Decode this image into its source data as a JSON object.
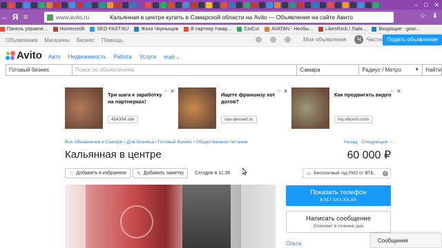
{
  "browser": {
    "ya_logo": "Я",
    "url": "www.avito.ru",
    "page_title": "Кальянная в центре купить в Самарской области на Avito — Объявления на сайте Авито",
    "tab_icon_colors": [
      "#2c3e50",
      "#e74c3c",
      "#2c3e50",
      "#3498db",
      "#2c3e50",
      "#27ae60",
      "#e67e22",
      "#c0392b",
      "#2c3e50",
      "#3498db",
      "#c0392b",
      "#2980b9",
      "#2c3e50",
      "#16a085",
      "#f39c12",
      "#c0392b",
      "#2c3e50",
      "#2980b9",
      "#8e44ad",
      "#e74c3c",
      "#2c3e50",
      "#27ae60",
      "#d35400",
      "#2c3e50",
      "#3498db",
      "#c0392b",
      "#2c3e50",
      "#f1c40f",
      "#2c3e50",
      "#e74c3c",
      "#2980b9",
      "#2c3e50",
      "#27ae60",
      "#c0392b",
      "#2c3e50",
      "#3498db",
      "#e67e22",
      "#2c3e50",
      "#16a085",
      "#c0392b",
      "#2c3e50",
      "#2980b9",
      "#2c3e50",
      "#e74c3c",
      "#2c3e50",
      "#f39c12",
      "#2c3e50",
      "#3498db",
      "#2c3e50",
      "#27ae60"
    ]
  },
  "bookmarks": [
    {
      "label": "Панель управле...",
      "color": "#e74c3c"
    },
    {
      "label": "Homecredit",
      "color": "#c0392b"
    },
    {
      "label": "SEO-FAST.RU",
      "color": "#3498db"
    },
    {
      "label": "Жека Черныщов",
      "color": "#2980b9"
    },
    {
      "label": "В партнер товар...",
      "color": "#e74c3c"
    },
    {
      "label": "CatCut",
      "color": "#27ae60"
    },
    {
      "label": "AVATAN - Необы...",
      "color": "#e67e22"
    },
    {
      "label": "LikesRock / Лайк...",
      "color": "#c0392b"
    },
    {
      "label": "Входящие - gooc...",
      "color": "#2980b9"
    }
  ],
  "site_nav": {
    "links": [
      "Объявления",
      "Магазины",
      "Бизнес",
      "Помощь"
    ],
    "my_ads": "Мои объявления",
    "avatar_letter": "Ч",
    "account": "Частное лицо",
    "post_button": "Подать объявление"
  },
  "logo": {
    "text": "Avito",
    "dot_colors": [
      "#97cf26",
      "#ff6163",
      "#0af",
      "#a169f7"
    ]
  },
  "categories": [
    "Авто",
    "Недвижимость",
    "Работа",
    "Услуги",
    "ещё..."
  ],
  "search": {
    "category": "Готовый бизнес",
    "placeholder": "Поиск по объявлениям",
    "city": "Самара",
    "radius": "Радиус / Метро",
    "button": "Найти"
  },
  "ads": [
    {
      "text": "Три шага к заработку на партнерках!",
      "domain": "454354.site",
      "img": "#b47a5a"
    },
    {
      "text": "Ищете франшизу хот догов?",
      "domain": "vau-dessert.ru",
      "img": "#c98a4a"
    },
    {
      "text": "Как продвигать видео",
      "domain": "my.viboom.com",
      "img": "#9a9a7a"
    }
  ],
  "breadcrumbs": "Все объявления в Самаре / Для бизнеса / Готовый бизнес / Общественное питание",
  "nav_prev": "Назад",
  "nav_next": "Следующее →",
  "listing": {
    "title": "Кальянная в центре",
    "price": "60 000 ₽",
    "favorite": "Добавить в избранное",
    "note": "Добавить заметку",
    "date": "Сегодня в 11:36",
    "credit": "Бесплатный год РКО от ВТБ"
  },
  "contact": {
    "show_phone": "Показать телефон",
    "phone_masked": "8 917 XXX-XX-XX",
    "write": "Написать сообщение",
    "reply_time": "Отвечает в течение дня",
    "seller": "Ольга"
  },
  "messages_tab": "Сообщения"
}
